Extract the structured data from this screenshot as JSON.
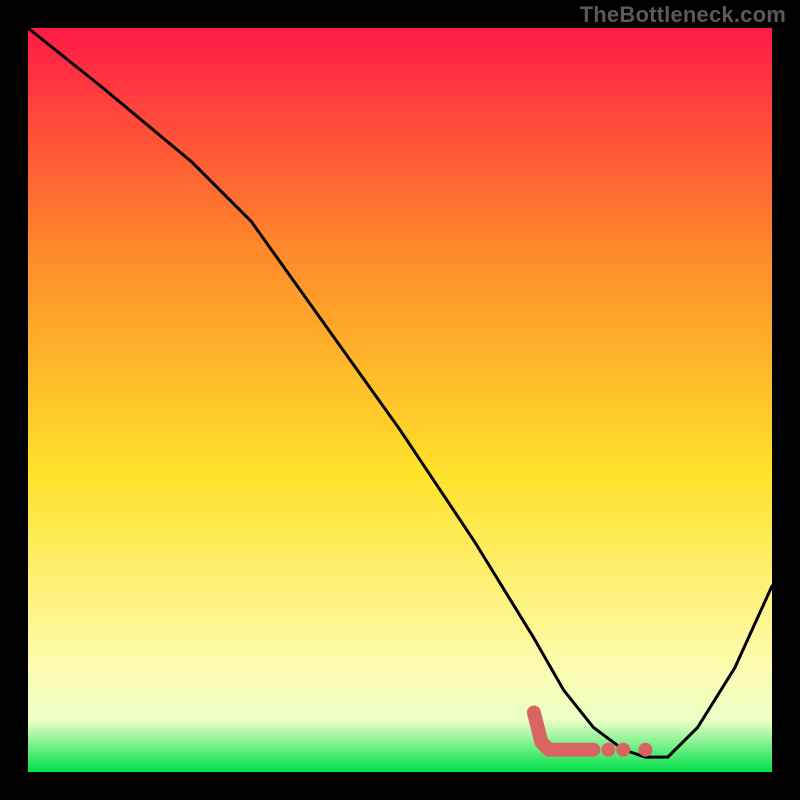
{
  "watermark": "TheBottleneck.com",
  "colors": {
    "frame": "#000000",
    "curve": "#000000",
    "marker": "#d96563",
    "gradient_top": "#ff1a47",
    "gradient_upper": "#ff8a2a",
    "gradient_mid": "#ffe22a",
    "gradient_band_upper": "#fdfcb0",
    "gradient_band_lower": "#ecffc6",
    "gradient_bottom": "#00e04a"
  },
  "chart_data": {
    "type": "line",
    "title": "",
    "xlabel": "",
    "ylabel": "",
    "xlim": [
      0,
      100
    ],
    "ylim": [
      0,
      100
    ],
    "grid": false,
    "legend": false,
    "series": [
      {
        "name": "bottleneck-curve",
        "x": [
          0,
          10,
          22,
          30,
          40,
          50,
          60,
          68,
          72,
          76,
          80,
          83,
          86,
          90,
          95,
          100
        ],
        "y": [
          100,
          92,
          82,
          74,
          60,
          46,
          31,
          18,
          11,
          6,
          3,
          2,
          2,
          6,
          14,
          25
        ]
      }
    ],
    "markers": [
      {
        "name": "highlight-segment",
        "shape": "thick-line",
        "points": [
          {
            "x": 68,
            "y": 8
          },
          {
            "x": 69,
            "y": 4
          },
          {
            "x": 70,
            "y": 3
          },
          {
            "x": 74,
            "y": 3
          },
          {
            "x": 76,
            "y": 3
          }
        ]
      },
      {
        "name": "highlight-dot-1",
        "shape": "dot",
        "x": 78,
        "y": 3
      },
      {
        "name": "highlight-dot-2",
        "shape": "dot",
        "x": 80,
        "y": 3
      },
      {
        "name": "highlight-dot-3",
        "shape": "dot",
        "x": 83,
        "y": 3
      }
    ]
  }
}
